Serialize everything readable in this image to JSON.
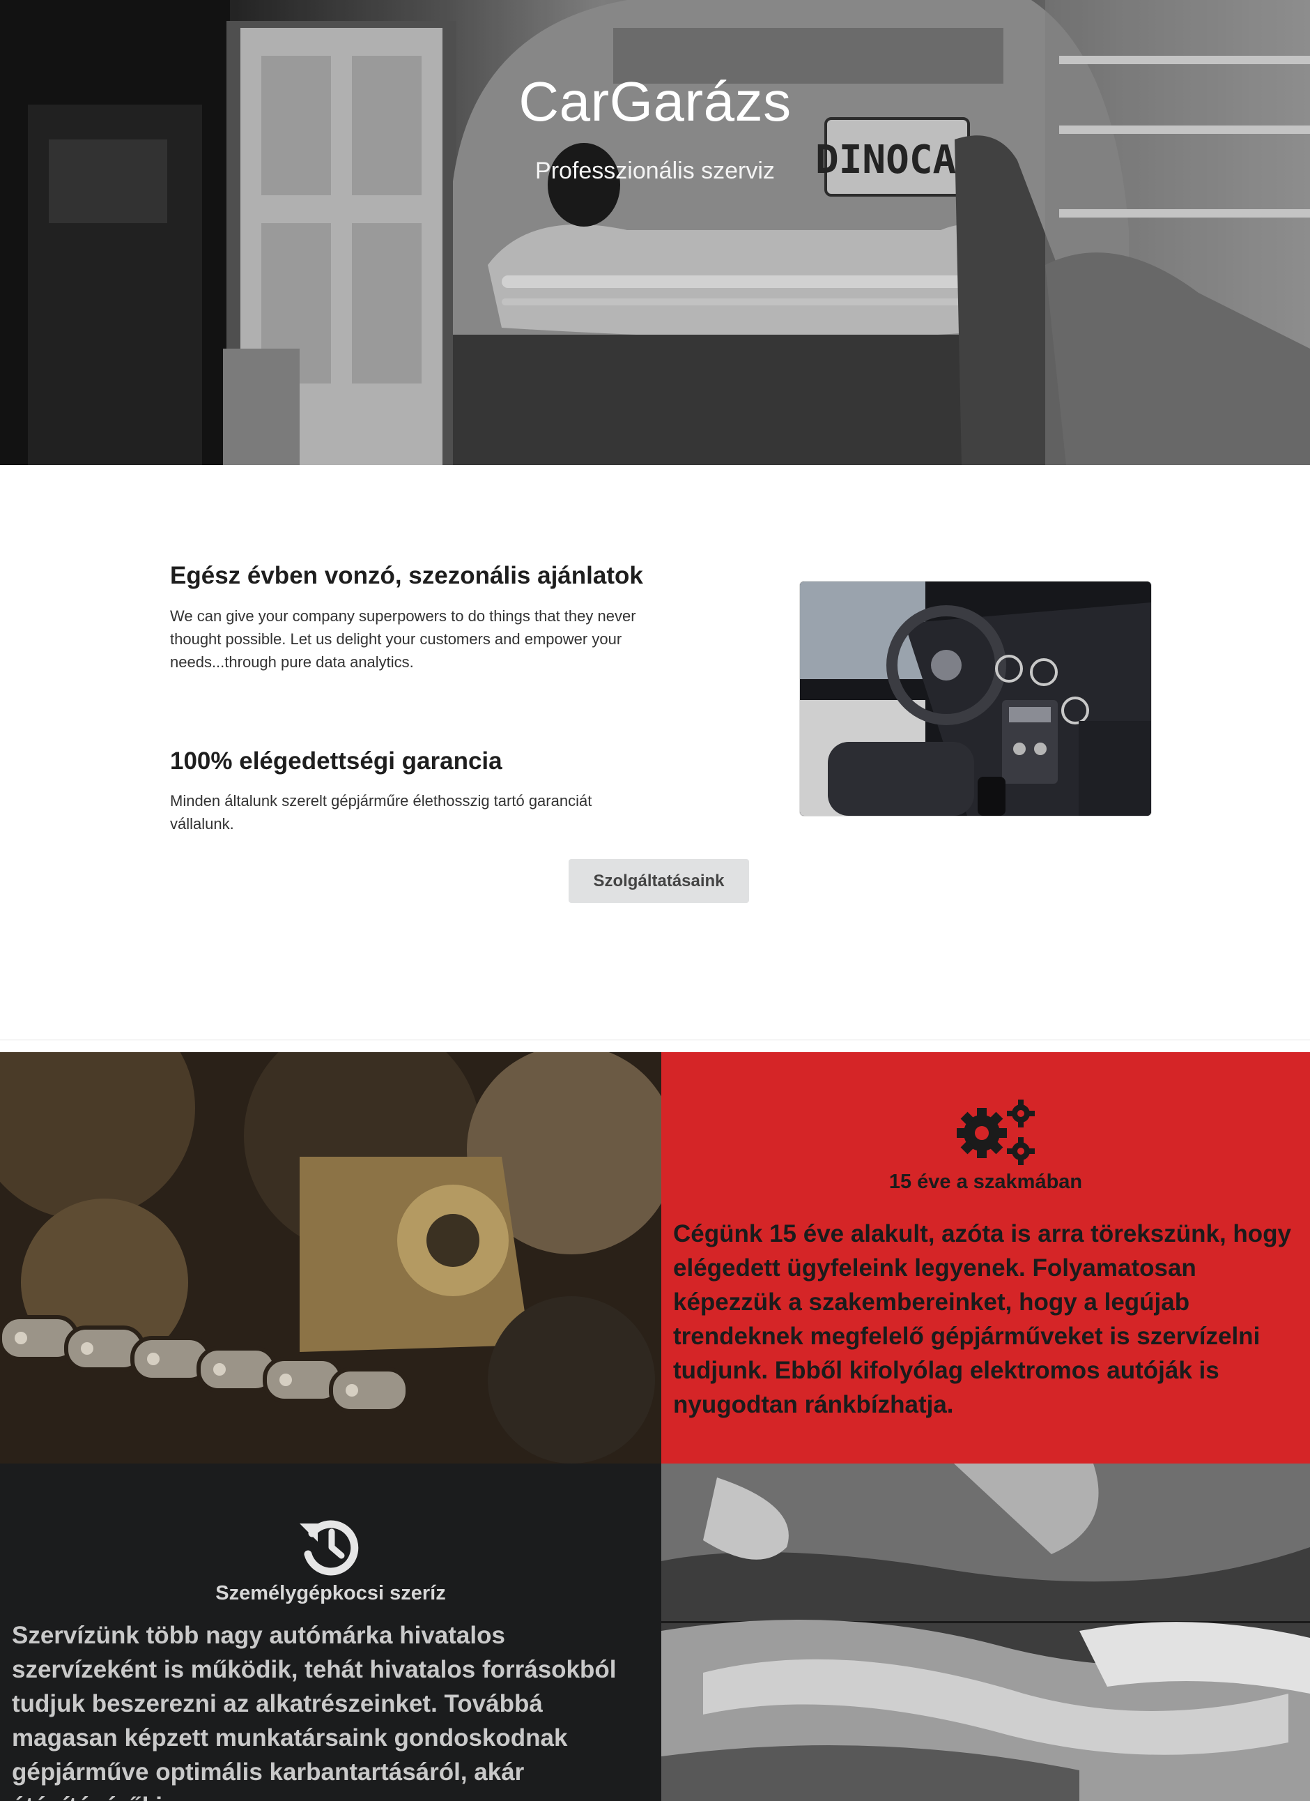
{
  "hero": {
    "title": "CarGarázs",
    "subtitle": "Professzionális szerviz",
    "image": "black-and-white photo of mechanic lying under a vintage Beetle car in a garage",
    "license_plate": "DINOCAR"
  },
  "intro": {
    "offer_title": "Egész évben vonzó, szezonális ajánlatok",
    "offer_text": "We can give your company superpowers to do things that they never thought possible. Let us delight your customers and empower your needs...through pure data analytics.",
    "guarantee_title": "100% elégedettségi garancia",
    "guarantee_text": "Minden általunk szerelt gépjárműre élethosszig tartó garanciát vállalunk.",
    "image": "luxury car interior with steering wheel and dashboard",
    "services_button": "Szolgáltatásaink"
  },
  "panels": {
    "experience": {
      "icon": "cogs-icon",
      "heading": "15 éve a szakmában",
      "text": "Cégünk 15 éve alakult, azóta is arra törekszünk, hogy elégedett ügyfeleink legyenek. Folyamatosan képezzük a szakembereinket, hogy a legújab trendeknek megfelelő gépjárműveket is szervízelni tudjunk. Ebből kifolyólag elektromos autóják is nyugodtan ránkbízhatja.",
      "background": "#d52527"
    },
    "service": {
      "icon": "history-icon",
      "heading": "Személygépkocsi szeríz",
      "text": "Szervízünk több nagy autómárka hivatalos szervízeként is működik, tehát hivatalos forrásokból tudjuk beszerezni az alkatrészeinket. Továbbá magasan képzett munkatársaink gondoskodnak gépjárműve optimális karbantartásáról, akár átépítéséről is.",
      "background": "#1b1c1d"
    },
    "gears_image": "close-up of engine gears and timing chain",
    "tools_image": "close-up of wrenches in black and white"
  },
  "colors": {
    "accent_red": "#d52527",
    "dark": "#1b1c1d",
    "button_gray": "#e0e1e2"
  }
}
